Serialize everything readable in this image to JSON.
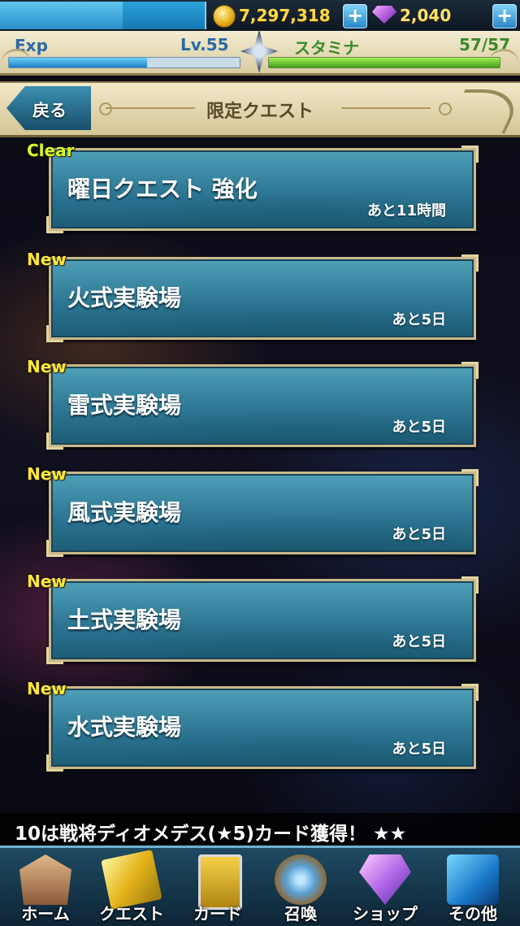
{
  "status": {
    "gold": "7,297,318",
    "gems": "2,040",
    "add_gold_label": "+",
    "add_gems_label": "+",
    "meter_fraction": 0.6
  },
  "player": {
    "exp_label": "Exp",
    "exp_fraction": 0.6,
    "level": "Lv.55",
    "stamina_label": "スタミナ",
    "stamina_value": "57/57",
    "stamina_fraction": 1.0
  },
  "header": {
    "back_label": "戻る",
    "title": "限定クエスト"
  },
  "quests": [
    {
      "badge": "Clear",
      "name": "曜日クエスト 強化",
      "time": "あと11時間"
    },
    {
      "badge": "New",
      "name": "火式実験場",
      "time": "あと5日"
    },
    {
      "badge": "New",
      "name": "雷式実験場",
      "time": "あと5日"
    },
    {
      "badge": "New",
      "name": "風式実験場",
      "time": "あと5日"
    },
    {
      "badge": "New",
      "name": "土式実験場",
      "time": "あと5日"
    },
    {
      "badge": "New",
      "name": "水式実験場",
      "time": "あと5日"
    }
  ],
  "ticker": {
    "text": "10は戦将ディオメデス(★5)カード獲得！ ★★"
  },
  "nav": [
    {
      "label": "ホーム",
      "icon": "home-icon"
    },
    {
      "label": "クエスト",
      "icon": "quest-icon"
    },
    {
      "label": "カード",
      "icon": "card-icon"
    },
    {
      "label": "召喚",
      "icon": "summon-icon"
    },
    {
      "label": "ショップ",
      "icon": "shop-icon"
    },
    {
      "label": "その他",
      "icon": "other-icon"
    }
  ],
  "colors": {
    "accent_blue": "#2a87c9",
    "gold_text": "#ffd84a",
    "stamina_green": "#3f9e19",
    "badge_new": "#ffe93a",
    "badge_clear": "#d6ff2a"
  }
}
